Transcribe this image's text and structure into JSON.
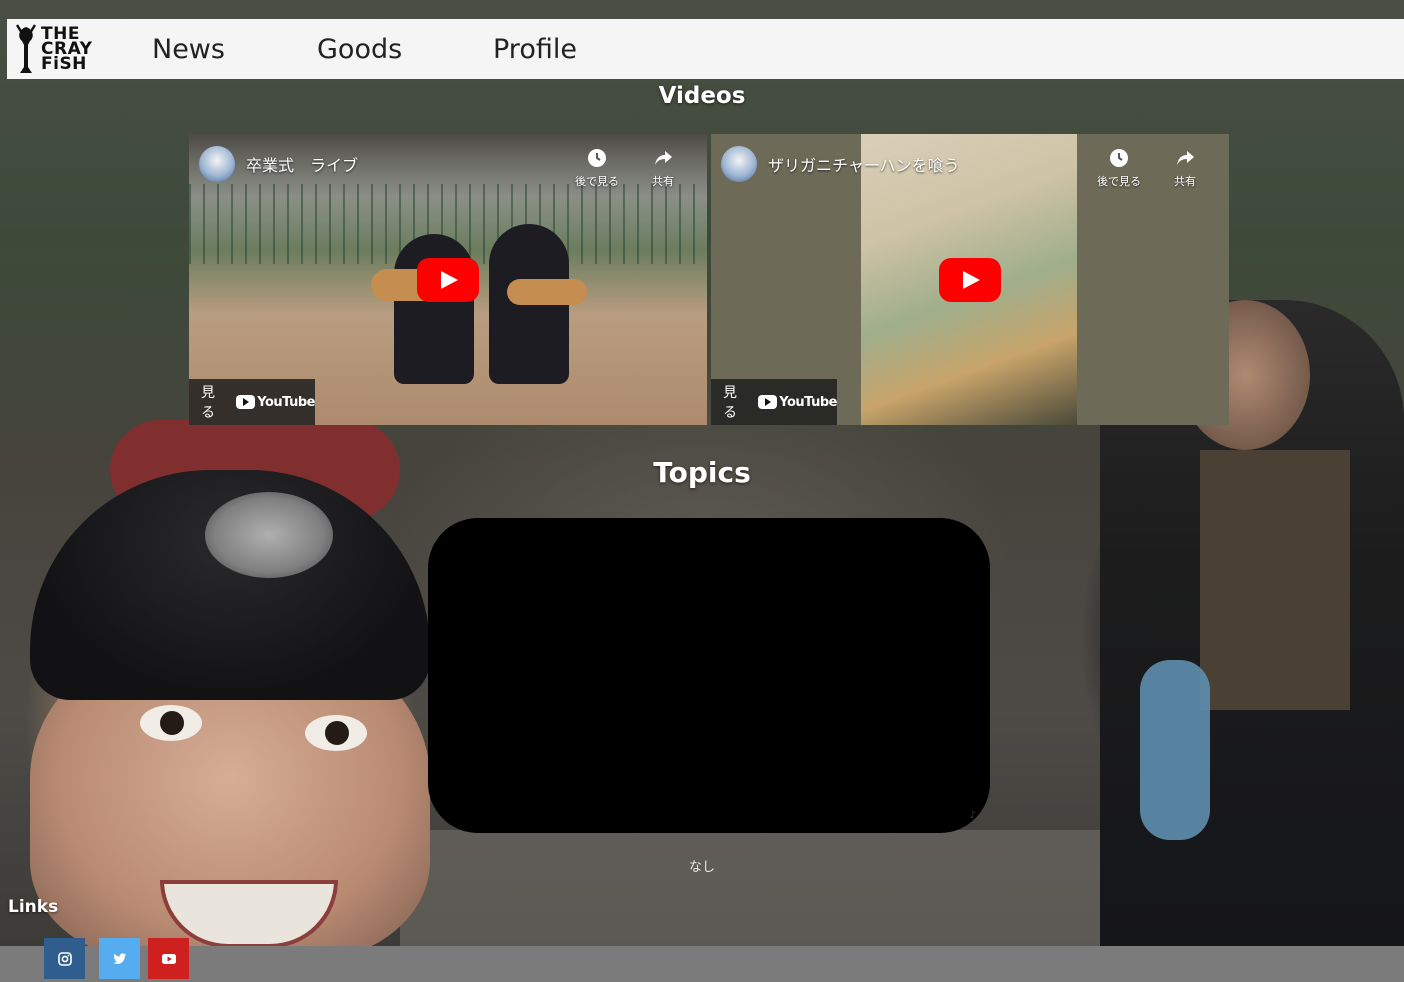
{
  "brand": {
    "line1": "THE",
    "line2": "CRAY",
    "line3": "FiSH"
  },
  "nav": {
    "items": [
      "News",
      "Goods",
      "Profile"
    ]
  },
  "sections": {
    "videos_title": "Videos",
    "topics_title": "Topics",
    "links_title": "Links"
  },
  "videos": [
    {
      "title": "卒業式　ライブ",
      "watch_later": "後で見る",
      "share": "共有",
      "watch_on": "見る",
      "platform": "YouTube"
    },
    {
      "title": "ザリガニチャーハンを喰う",
      "watch_later": "後で見る",
      "share": "共有",
      "watch_on": "見る",
      "platform": "YouTube"
    }
  ],
  "topics": {
    "empty_text": "なし"
  },
  "social": [
    {
      "name": "instagram",
      "icon": "instagram-icon",
      "color": "#2f5d8e"
    },
    {
      "name": "twitter",
      "icon": "twitter-icon",
      "color": "#55acee"
    },
    {
      "name": "youtube",
      "icon": "youtube-icon",
      "color": "#cd201f"
    }
  ],
  "colors": {
    "header_bg": "#f5f5f5",
    "footer_bg": "#7b7b7b",
    "play_red": "#ff0000"
  }
}
